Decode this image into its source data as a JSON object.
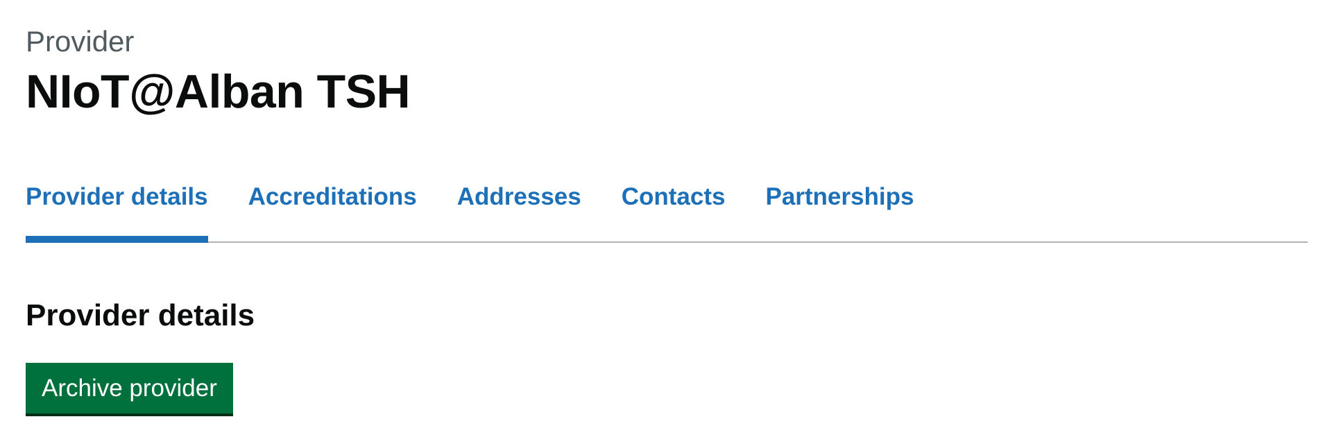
{
  "header": {
    "caption": "Provider",
    "title": "NIoT@Alban TSH"
  },
  "tabs": [
    {
      "label": "Provider details",
      "selected": true
    },
    {
      "label": "Accreditations",
      "selected": false
    },
    {
      "label": "Addresses",
      "selected": false
    },
    {
      "label": "Contacts",
      "selected": false
    },
    {
      "label": "Partnerships",
      "selected": false
    }
  ],
  "section": {
    "heading": "Provider details",
    "archive_button_label": "Archive provider"
  },
  "colors": {
    "link": "#1d70b8",
    "button": "#00703c",
    "text": "#0b0c0c",
    "secondary_text": "#505a5f",
    "divider": "#b1b4b6"
  }
}
